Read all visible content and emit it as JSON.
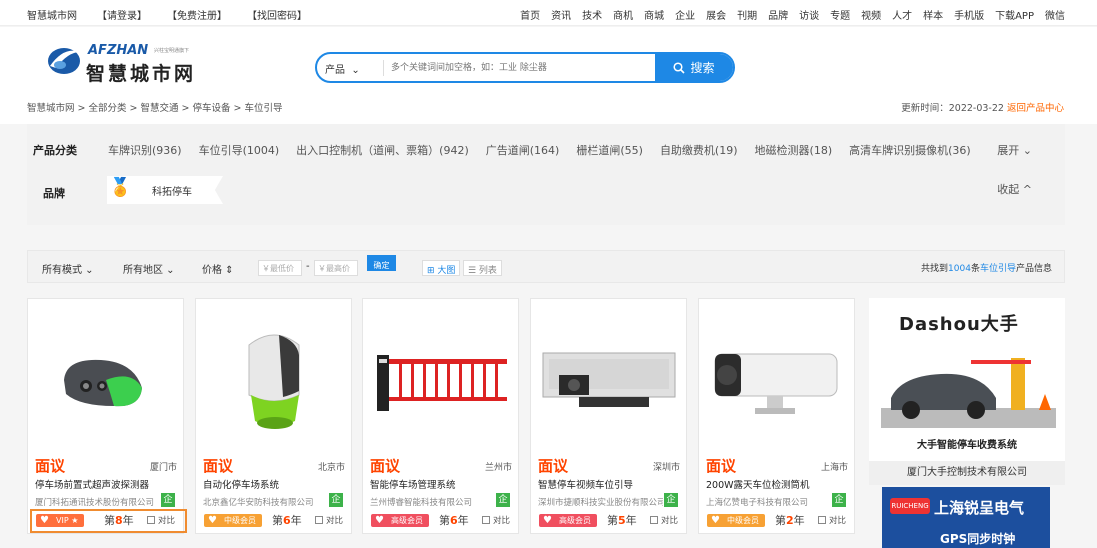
{
  "topbar": {
    "left": [
      "智慧城市网",
      "【请登录】",
      "【免费注册】",
      "【找回密码】"
    ],
    "right": [
      "首页",
      "资讯",
      "技术",
      "商机",
      "商城",
      "企业",
      "展会",
      "刊期",
      "品牌",
      "访谈",
      "专题",
      "视频",
      "人才",
      "样本",
      "手机版",
      "下载APP",
      "微信"
    ]
  },
  "logo": {
    "en": "AFZHAN",
    "tagline": "兴柱宝明通旗下",
    "cn": "智慧城市网"
  },
  "search": {
    "category": "产品",
    "placeholder": "多个关键词间加空格，如：工业 除尘器",
    "button": "搜索"
  },
  "breadcrumb": "智慧城市网 > 全部分类 > 智慧交通 > 停车设备 > 车位引导",
  "updated": {
    "label": "更新时间：2022-03-22",
    "link": "返回产品中心"
  },
  "filter": {
    "category_label": "产品分类",
    "categories": [
      "车牌识别(936)",
      "车位引导(1004)",
      "出入口控制机（道闸、票箱）(942)",
      "广告道闸(164)",
      "栅栏道闸(55)",
      "自助缴费机(19)",
      "地磁检测器(18)",
      "高清车牌识别摄像机(36)"
    ],
    "expand": "展开 ⌄",
    "brand_label": "品牌",
    "brand": "科拓停车",
    "collapse": "收起 ^"
  },
  "sortbar": {
    "mode": "所有模式 ⌄",
    "region": "所有地区 ⌄",
    "price": "价格 ⇕",
    "low": "￥最低价",
    "dash": "-",
    "high": "￥最高价",
    "go": "确定",
    "big": "⊞ 大图",
    "list": "☰ 列表",
    "found_pre": "共找到",
    "found_num": "1004",
    "found_mid": "条",
    "found_cat": "车位引导",
    "found_post": "产品信息"
  },
  "products": [
    {
      "price": "面议",
      "city": "厦门市",
      "title": "停车场前置式超声波探测器",
      "company": "厦门科拓通讯技术股份有限公司",
      "badge": "VIP ★",
      "year_pre": "第",
      "year": "8",
      "year_post": "年",
      "compare": "对比"
    },
    {
      "price": "面议",
      "city": "北京市",
      "title": "自动化停车场系统",
      "company": "北京鑫亿华安防科技有限公司",
      "badge": "中级会员",
      "year_pre": "第",
      "year": "6",
      "year_post": "年",
      "compare": "对比"
    },
    {
      "price": "面议",
      "city": "兰州市",
      "title": "智能停车场管理系统",
      "company": "兰州博睿智能科技有限公司",
      "badge": "高级会员",
      "year_pre": "第",
      "year": "6",
      "year_post": "年",
      "compare": "对比"
    },
    {
      "price": "面议",
      "city": "深圳市",
      "title": "智慧停车视频车位引导",
      "company": "深圳市捷顺科技实业股份有限公司",
      "badge": "高级会员",
      "year_pre": "第",
      "year": "5",
      "year_post": "年",
      "compare": "对比"
    },
    {
      "price": "面议",
      "city": "上海市",
      "title": "200W露天车位检测筒机",
      "company": "上海亿赞电子科技有限公司",
      "badge": "中级会员",
      "year_pre": "第",
      "year": "2",
      "year_post": "年",
      "compare": "对比"
    }
  ],
  "qi_label": "企",
  "ad": {
    "brand": "Dashou大手",
    "caption": "大手智能停车收费系统",
    "company": "厦门大手控制技术有限公司",
    "bottom_logo": "RUICHENG",
    "bottom_title": "上海锐呈电气",
    "bottom_sub": "GPS同步时钟"
  },
  "colors": {
    "accent": "#1e88e5",
    "price": "#ff4400",
    "vip": "#ff6f3c",
    "mid": "#f7a134",
    "high": "#f04f5f"
  }
}
